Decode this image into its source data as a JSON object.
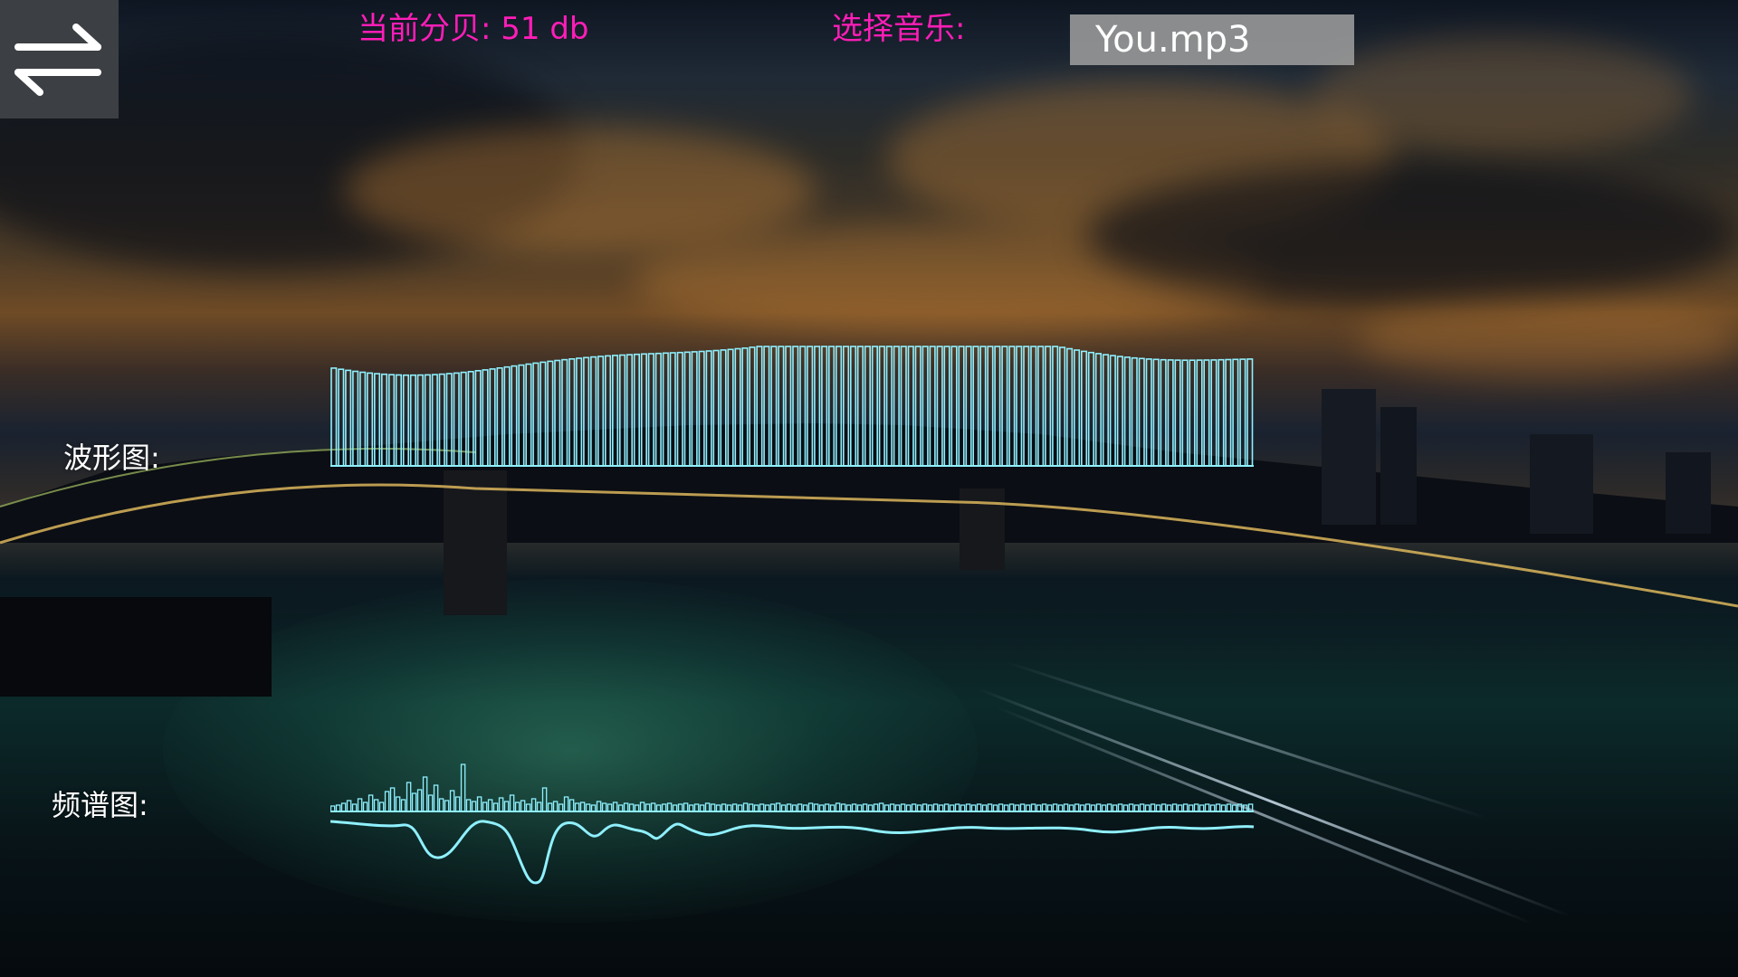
{
  "header": {
    "menu_icon": "swap-arrows-icon",
    "decibel_label": "当前分贝: 51 db",
    "choose_music_label": "选择音乐:",
    "selected_music": "You.mp3"
  },
  "labels": {
    "waveform": "波形图:",
    "spectrum": "频谱图:"
  },
  "colors": {
    "accent_label": "#ff1db8",
    "visualizer_stroke": "#8ff0ff",
    "select_bg": "#a0a0a0",
    "menu_bg": "#3c3f43"
  },
  "background": {
    "description_icon": "night-city-bridge-photo"
  }
}
